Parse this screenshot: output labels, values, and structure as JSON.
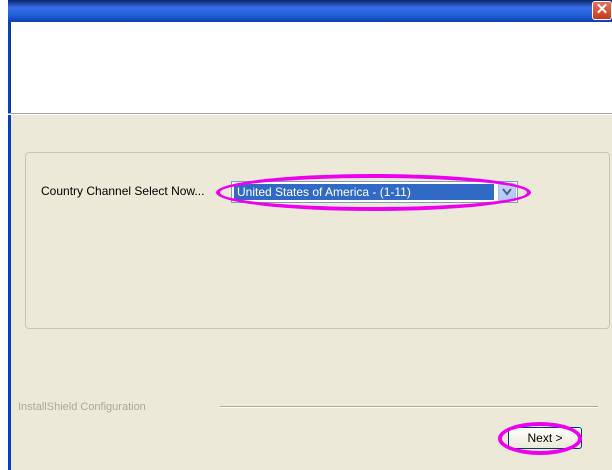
{
  "titlebar": {
    "close_icon": "close-icon",
    "close_glyph": "✕"
  },
  "main": {
    "country_label": "Country Channel Select Now...",
    "country_select": {
      "selected": "United States of America - (1-11)",
      "arrow_icon": "chevron-down-icon"
    }
  },
  "footer": {
    "brand_label": "InstallShield Configuration",
    "next_label": "Next >"
  },
  "colors": {
    "highlight": "#ee00ee",
    "selection": "#316ac5",
    "dialog_bg": "#ece9d8",
    "titlebar": "#1f5fd6"
  }
}
